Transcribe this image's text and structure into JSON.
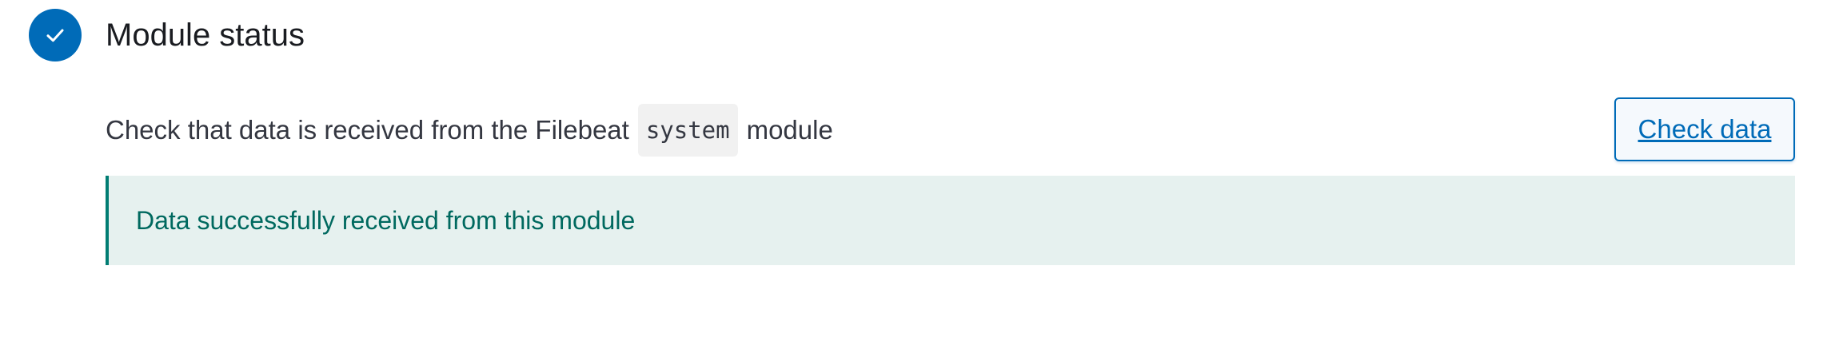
{
  "step": {
    "title": "Module status",
    "status": "complete",
    "icon": "check-icon"
  },
  "description": {
    "prefix": "Check that data is received from the Filebeat",
    "code": "system",
    "suffix": "module"
  },
  "button": {
    "label": "Check data"
  },
  "callout": {
    "message": "Data successfully received from this module",
    "type": "success"
  },
  "colors": {
    "primary": "#006bb8",
    "success_text": "#00695f",
    "success_bg": "#e6f1ef",
    "success_border": "#017d73"
  }
}
